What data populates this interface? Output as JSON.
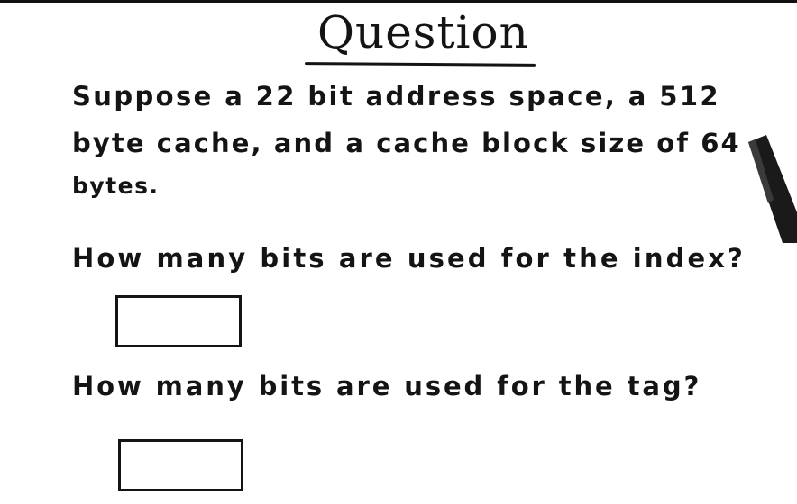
{
  "title": "Question",
  "question": {
    "line1": "Suppose a 22 bit address space, a 512",
    "line2": "byte cache, and a cache block size of 64",
    "line3": "bytes."
  },
  "asks": [
    {
      "text": "How many bits are used for the index?",
      "answer": ""
    },
    {
      "text": "How many bits are used for the tag?",
      "answer": ""
    }
  ],
  "colors": {
    "ink": "#141414",
    "paper": "#ffffff",
    "pen": "#1a1a1a"
  },
  "icons": {
    "pen": "marker-pen-icon"
  }
}
